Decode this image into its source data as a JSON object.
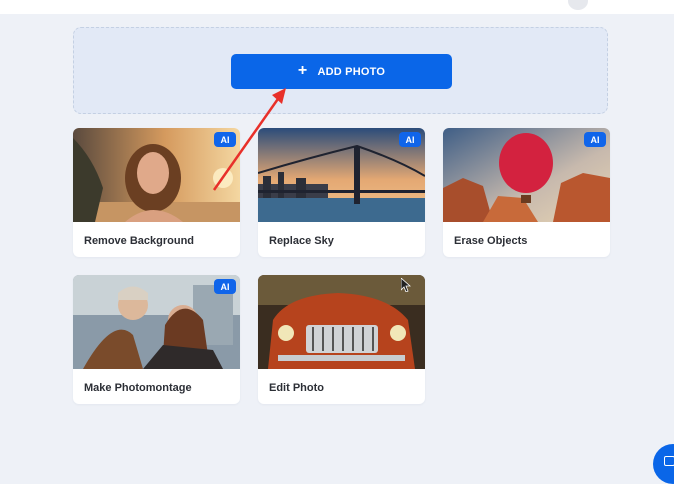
{
  "upload": {
    "button_label": "ADD PHOTO",
    "button_icon": "plus-icon"
  },
  "badge": "AI",
  "cards": [
    {
      "label": "Remove Background",
      "badge": "AI"
    },
    {
      "label": "Replace Sky",
      "badge": "AI"
    },
    {
      "label": "Erase Objects",
      "badge": "AI"
    },
    {
      "label": "Make Photomontage",
      "badge": "AI"
    },
    {
      "label": "Edit Photo"
    }
  ],
  "colors": {
    "accent": "#0a66e8",
    "annotation_arrow": "#e8302a",
    "background": "#eef1f7"
  }
}
